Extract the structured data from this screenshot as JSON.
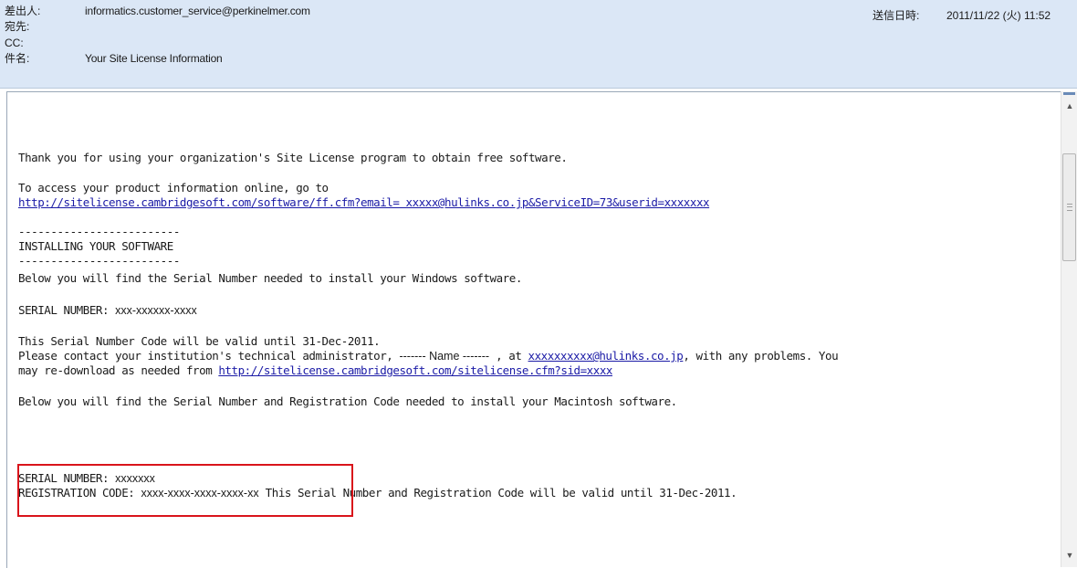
{
  "header": {
    "from_label": "差出人:",
    "from_value": "informatics.customer_service@perkinelmer.com",
    "to_label": "宛先:",
    "cc_label": "CC:",
    "subject_label": "件名:",
    "subject_value": "Your Site License Information",
    "sent_label": "送信日時:",
    "sent_value": "2011/11/22 (火) 11:52"
  },
  "body": {
    "l1": "Thank you for using your organization's Site License program to obtain free software.",
    "l2": "To access your product information online, go to",
    "l3_link": "http://sitelicense.cambridgesoft.com/software/ff.cfm?email= xxxxx@hulinks.co.jp&ServiceID=73&userid=xxxxxxx",
    "rule1": "-------------------------",
    "install_heading": "INSTALLING YOUR SOFTWARE",
    "rule2": "-------------------------",
    "l_win": "Below you will find the Serial Number needed to install your Windows software.",
    "serial_label": "SERIAL NUMBER: ",
    "serial_value": "xxx-xxxxxx-xxxx",
    "valid1": "This Serial Number Code will be valid until 31-Dec-2011.",
    "contact_a": "Please contact your institution's technical administrator, ",
    "contact_name": "------- Name -------",
    "contact_b": " , at ",
    "contact_email": " xxxxxxxxxx@hulinks.co.jp",
    "contact_c": ", with any problems. You",
    "redl_a": "may re-download as needed from ",
    "redl_link": "http://sitelicense.cambridgesoft.com/sitelicense.cfm?sid=xxxx",
    "l_mac": "Below you will find the Serial Number and Registration Code needed to install your Macintosh software.",
    "mac_serial_label": "SERIAL NUMBER: ",
    "mac_serial_value": "xxxxxxx",
    "reg_label": "REGISTRATION CODE: ",
    "reg_value": "xxxx-xxxx-xxxx-xxxx-xx",
    "valid2": " This Serial Number and Registration Code will be valid until 31-Dec-2011."
  },
  "colors": {
    "header_bg": "#dbe7f6",
    "link": "#1a1aa6",
    "highlight": "#d9141b"
  },
  "icons": {
    "scroll_up": "triangle-up-icon",
    "scroll_down": "triangle-down-icon"
  }
}
